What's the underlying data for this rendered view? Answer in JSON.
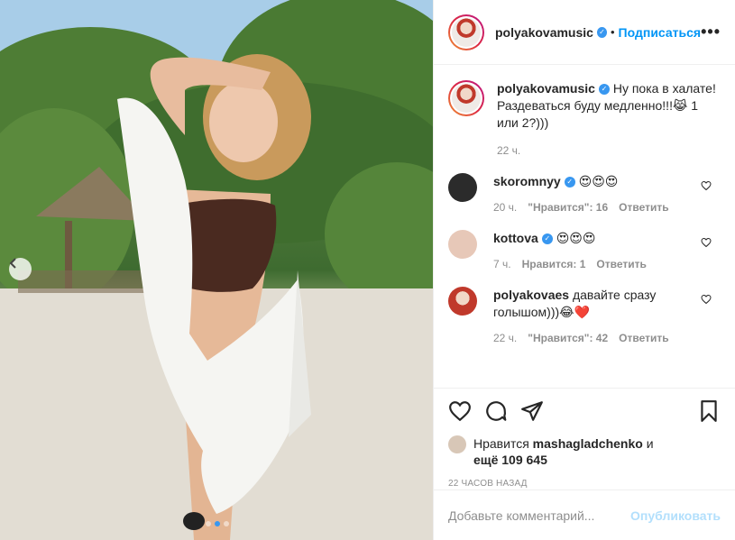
{
  "post": {
    "author": "polyakovamusic",
    "follow_label": "Подписаться",
    "more_label": "•••",
    "verified_mark": "✓"
  },
  "caption": {
    "user": "polyakovamusic",
    "text": "Ну пока в халате! Раздеваться буду медленно!!!😹 1 или 2?)))",
    "time": "22 ч."
  },
  "comments": [
    {
      "user": "skoromnyy",
      "text": "😍😍😍",
      "time": "20 ч.",
      "likes": "\"Нравится\": 16",
      "reply": "Ответить"
    },
    {
      "user": "kottova",
      "text": "😍😍😍",
      "time": "7 ч.",
      "likes": "Нравится: 1",
      "reply": "Ответить"
    },
    {
      "user": "polyakovaes",
      "text": "давайте сразу голышом)))😂❤️",
      "time": "22 ч.",
      "likes": "\"Нравится\": 42",
      "reply": "Ответить"
    }
  ],
  "likes": {
    "prefix": "Нравится",
    "user": "mashagladchenko",
    "and": "и",
    "others": "ещё 109 645"
  },
  "posted_time": "22 часов назад",
  "add_comment": {
    "placeholder": "Добавьте комментарий...",
    "publish_label": "Опубликовать"
  },
  "icons": {
    "like": "heart-icon",
    "comment": "comment-icon",
    "share": "paper-plane-icon",
    "save": "bookmark-icon",
    "prev": "chevron-left-icon"
  },
  "colors": {
    "accent": "#0095f6",
    "verified": "#3897f0",
    "muted": "#8e8e8e",
    "publish_disabled": "#b2dffc"
  },
  "carousel": {
    "current": 2,
    "total": 3
  }
}
